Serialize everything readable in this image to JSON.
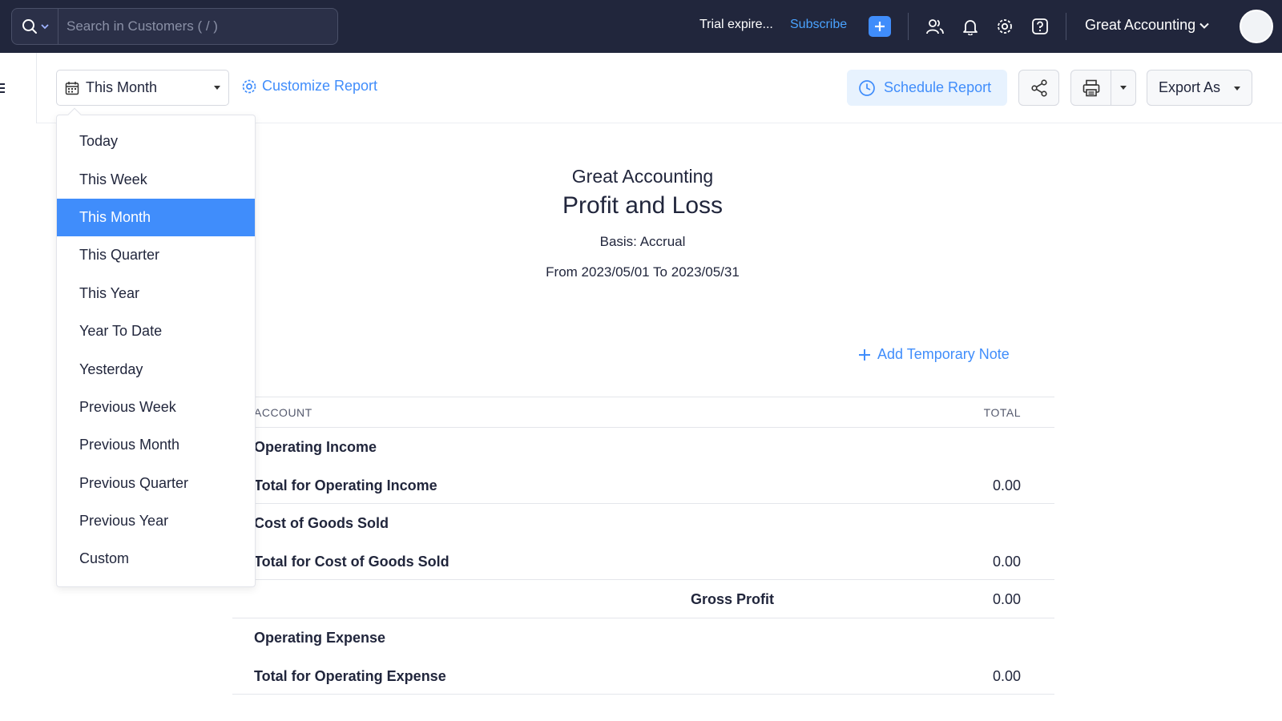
{
  "topbar": {
    "search_placeholder": "Search in Customers ( / )",
    "trial_text": "Trial expire...",
    "subscribe_label": "Subscribe",
    "org_name": "Great Accounting"
  },
  "toolbar": {
    "period_value": "This Month",
    "customize_label": "Customize Report",
    "schedule_label": "Schedule Report",
    "export_label": "Export As"
  },
  "report": {
    "company": "Great Accounting",
    "title": "Profit and Loss",
    "basis": "Basis: Accrual",
    "range": "From 2023/05/01 To 2023/05/31",
    "add_note_label": "Add Temporary Note",
    "columns": {
      "account": "ACCOUNT",
      "total": "TOTAL"
    },
    "rows": [
      {
        "account": "Operating Income",
        "total": ""
      },
      {
        "account": "Total for Operating Income",
        "total": "0.00"
      },
      {
        "account": "Cost of Goods Sold",
        "total": ""
      },
      {
        "account": "Total for Cost of Goods Sold",
        "total": "0.00"
      },
      {
        "account": "Gross Profit",
        "total": "0.00"
      },
      {
        "account": "Operating Expense",
        "total": ""
      },
      {
        "account": "Total for Operating Expense",
        "total": "0.00"
      }
    ]
  },
  "period_dropdown": {
    "selected": "This Month",
    "options": [
      "Today",
      "This Week",
      "This Month",
      "This Quarter",
      "This Year",
      "Year To Date",
      "Yesterday",
      "Previous Week",
      "Previous Month",
      "Previous Quarter",
      "Previous Year",
      "Custom"
    ]
  },
  "colors": {
    "topbar_bg": "#21263c",
    "accent": "#408dfb",
    "subscribe_link": "#4aa3ff"
  }
}
